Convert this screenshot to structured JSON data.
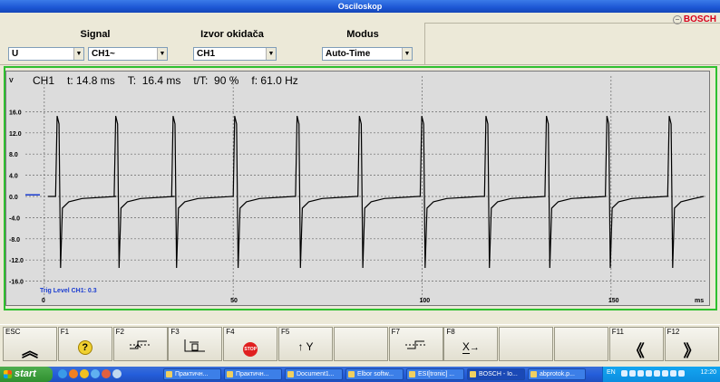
{
  "window": {
    "title": "Osciloskop"
  },
  "brand": {
    "name": "BOSCH",
    "logo_icon": "bosch-logo-icon"
  },
  "controls": {
    "signal_label": "Signal",
    "trigger_source_label": "Izvor okidača",
    "mode_label": "Modus",
    "quantity_value": "U",
    "signal_value": "CH1~",
    "trigger_source_value": "CH1",
    "mode_value": "Auto-Time"
  },
  "readout": {
    "channel": "CH1",
    "t": "t: 14.8 ms",
    "period": "T:  16.4 ms",
    "duty": "t/T:  90 %",
    "freq": "f: 61.0 Hz"
  },
  "chart_data": {
    "type": "line",
    "title": "",
    "xlabel": "ms",
    "ylabel": "V",
    "xlim": [
      -5,
      175
    ],
    "ylim": [
      -20,
      20
    ],
    "x_ticks": [
      "0",
      "50",
      "100",
      "150"
    ],
    "x_tick_values": [
      0,
      50,
      100,
      150
    ],
    "y_ticks": [
      "16.0",
      "12.0",
      "8.0",
      "4.0",
      "0.0",
      "-4.0",
      "-8.0",
      "-12.0",
      "-16.0"
    ],
    "y_tick_values": [
      16,
      12,
      8,
      4,
      0,
      -4,
      -8,
      -12,
      -16
    ],
    "grid": true,
    "trigger_label": "Trig Level CH1:  0.3",
    "trigger_level": 0.3,
    "pulse_period_ms": 16.4,
    "pulse_starts_ms": [
      3.0,
      18.5,
      33.7,
      50.0,
      66.5,
      83.0,
      99.5,
      116.5,
      132.5,
      148.5,
      165.0
    ],
    "pulse_shape": {
      "baseline_v": 0.0,
      "positive_peak_v": 15.2,
      "negative_peak_v": -13.5,
      "settle_v": -1.0
    },
    "series": [
      {
        "color": "#000000"
      }
    ]
  },
  "fkeys": [
    {
      "key": "ESC",
      "icon": "double-chevron-up-icon"
    },
    {
      "key": "F1",
      "icon": "help-icon"
    },
    {
      "key": "F2",
      "icon": "trigger-rising-edge-icon"
    },
    {
      "key": "F3",
      "icon": "trigger-position-icon"
    },
    {
      "key": "F4",
      "icon": "stop-icon",
      "stop_text": "STOP"
    },
    {
      "key": "F5",
      "icon": "cursor-y-icon",
      "text": "Y"
    },
    {
      "key": "",
      "icon": ""
    },
    {
      "key": "F7",
      "icon": "trigger-level-icon"
    },
    {
      "key": "F8",
      "icon": "cursor-x-icon",
      "text": "X"
    },
    {
      "key": "",
      "icon": ""
    },
    {
      "key": "",
      "icon": ""
    },
    {
      "key": "F11",
      "icon": "double-chevron-left-icon"
    },
    {
      "key": "F12",
      "icon": "double-chevron-right-icon"
    }
  ],
  "taskbar": {
    "start_label": "start",
    "tasks": [
      {
        "label": "Практичн...",
        "active": false
      },
      {
        "label": "Практичн...",
        "active": false
      },
      {
        "label": "Document1...",
        "active": false
      },
      {
        "label": "Elbor softw...",
        "active": false
      },
      {
        "label": "ESI[tronic] ...",
        "active": false
      },
      {
        "label": "BOSCH - Io...",
        "active": true
      },
      {
        "label": "abprotok.p...",
        "active": false
      }
    ],
    "language": "EN",
    "clock": "12:20"
  },
  "colors": {
    "frame_green": "#2fc02f",
    "plot_bg": "#dcdcdc",
    "trace": "#000000",
    "trigger_marker": "#1a3cd0",
    "brand_red": "#d6001c"
  }
}
